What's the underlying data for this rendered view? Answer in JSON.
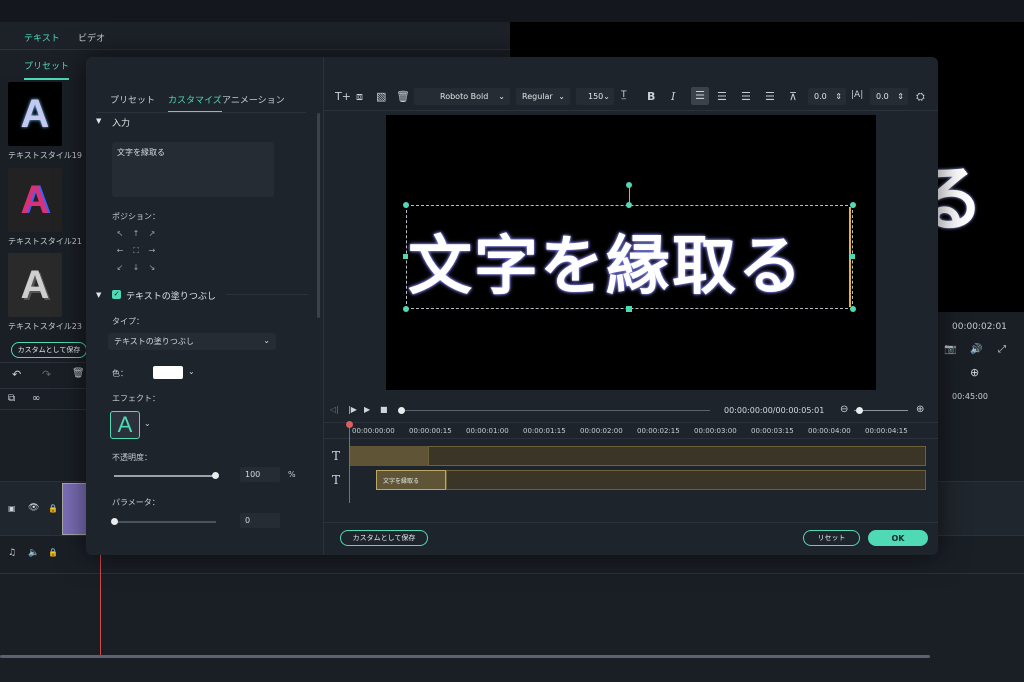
{
  "bg": {
    "tabs": [
      "テキスト",
      "ビデオ"
    ],
    "subtab": "プリセット",
    "thumbs": [
      {
        "label": "テキストスタイル19",
        "glyph": "A"
      },
      {
        "label": "テキストスタイル21",
        "glyph": "A"
      },
      {
        "label": "テキストスタイル23",
        "glyph": "A"
      }
    ],
    "save_custom": "カスタムとして保存",
    "preview_glyph": "る",
    "time": "00:00:02:01",
    "ruler_time": "00:45:00"
  },
  "modal": {
    "tabs": [
      "プリセット",
      "カスタマイズ",
      "アニメーション"
    ],
    "section_input": "入力",
    "input_text": "文字を縁取る",
    "position_label": "ポジション：",
    "fill_section": "テキストの塗りつぶし",
    "type_label": "タイプ：",
    "type_value": "テキストの塗りつぶし",
    "color_label": "色：",
    "effect_label": "エフェクト：",
    "effect_glyph": "A",
    "opacity_label": "不透明度：",
    "opacity_value": "100",
    "opacity_unit": "%",
    "param_label": "パラメータ：",
    "param_value": "0",
    "save_custom": "カスタムとして保存",
    "reset": "リセット",
    "ok": "OK"
  },
  "toolbar": {
    "font": "Roboto Bold",
    "weight": "Regular",
    "size": "150",
    "spacing1": "0.0",
    "spacing2": "0.0"
  },
  "canvas": {
    "text": "文字を縁取る"
  },
  "playback": {
    "timecode": "00:00:00:00/00:00:05:01"
  },
  "timeline": {
    "ruler": [
      "00:00:00:00",
      "00:00:00:15",
      "00:00:01:00",
      "00:00:01:15",
      "00:00:02:00",
      "00:00:02:15",
      "00:00:03:00",
      "00:00:03:15",
      "00:00:04:00",
      "00:00:04:15"
    ],
    "clip_label": "文字を縁取る",
    "track_icon": "T"
  }
}
